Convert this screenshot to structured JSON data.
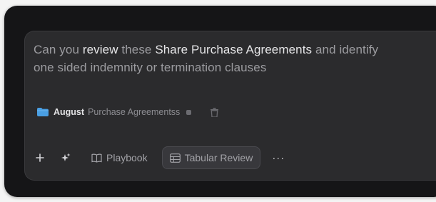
{
  "prompt": {
    "line1": {
      "t1": "Can you ",
      "b1": "review",
      "t2": " these ",
      "b2": "Share Purchase Agreements",
      "t3": " and identify"
    },
    "line2": "one sided indemnity or termination clauses"
  },
  "attachment": {
    "owner": "August",
    "name": "Purchase Agreementss",
    "icon": "folder-icon",
    "color": "#4a9fe3"
  },
  "toolbar": {
    "add_icon": "plus-icon",
    "sparkle_icon": "sparkle-icon",
    "playbook_label": "Playbook",
    "tabular_label": "Tabular Review",
    "more_label": "···"
  }
}
